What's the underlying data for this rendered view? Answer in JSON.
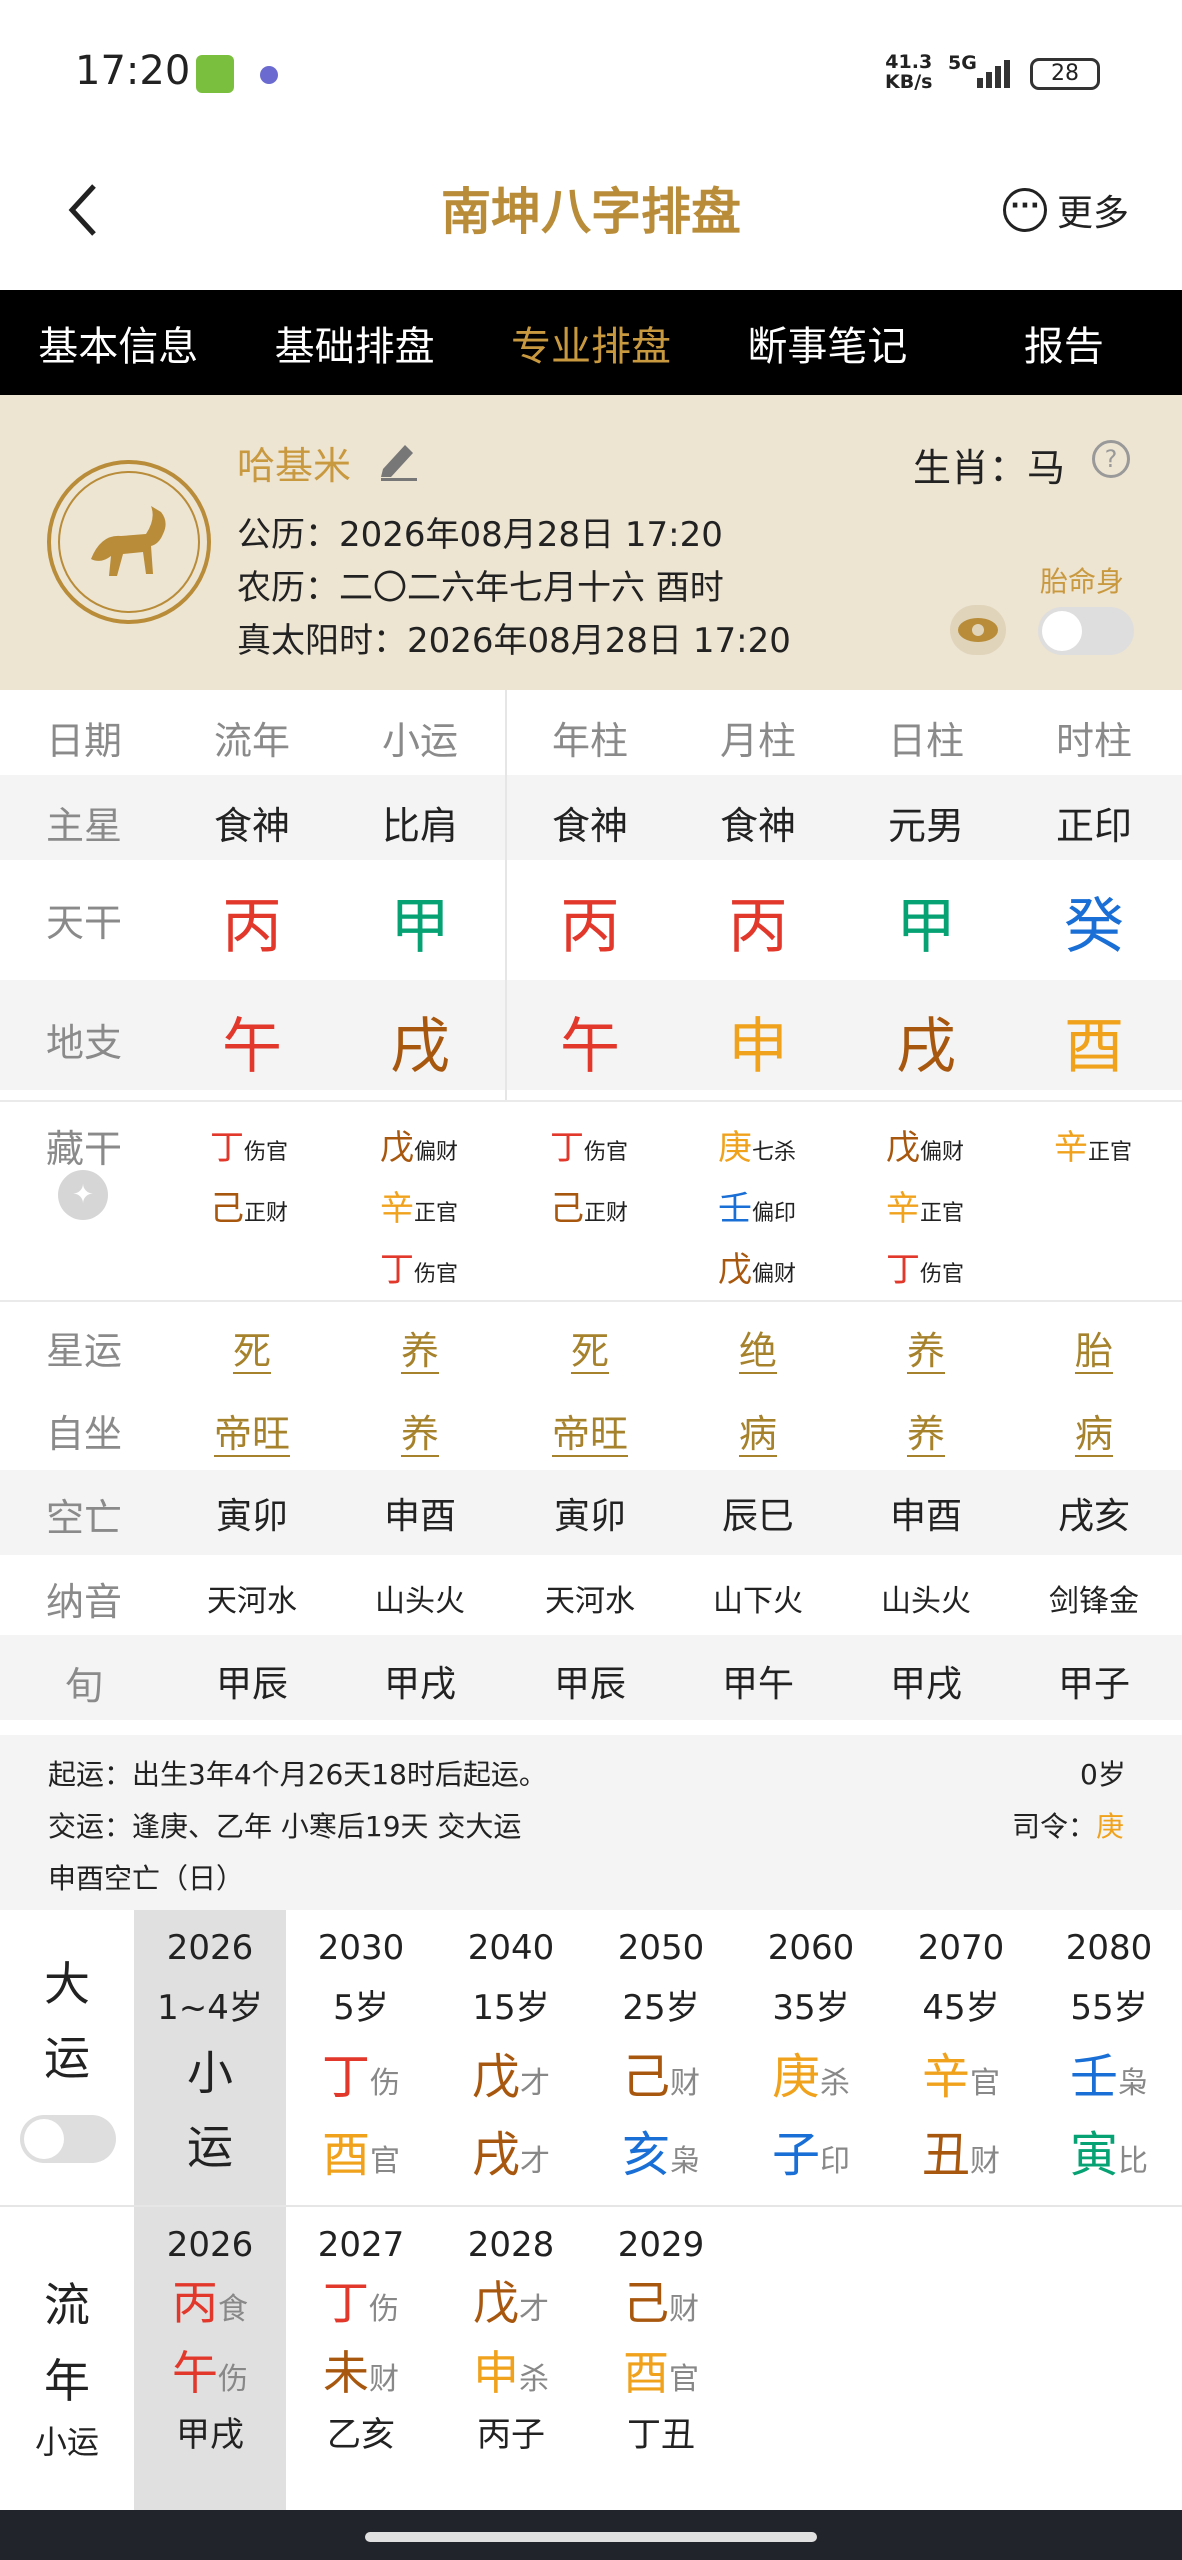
{
  "status": {
    "time": "17:20",
    "net_speed_top": "41.3",
    "net_speed_unit": "KB/s",
    "network": "5G",
    "battery": "28"
  },
  "header": {
    "title": "南坤八字排盘",
    "more": "更多"
  },
  "tabs": [
    "基本信息",
    "基础排盘",
    "专业排盘",
    "断事笔记",
    "报告"
  ],
  "profile": {
    "name": "哈基米",
    "zodiac_label": "生肖：",
    "zodiac": "马",
    "solar": "公历：2026年08月28日 17:20",
    "lunar": "农历：二〇二六年七月十六 酉时",
    "true_solar": "真太阳时：2026年08月28日 17:20",
    "taiming": "胎命身"
  },
  "table": {
    "headers": [
      "日期",
      "流年",
      "小运",
      "年柱",
      "月柱",
      "日柱",
      "时柱"
    ],
    "main_star_label": "主星",
    "main_star": [
      "食神",
      "比肩",
      "食神",
      "食神",
      "元男",
      "正印"
    ],
    "tiangan_label": "天干",
    "tiangan": [
      "丙",
      "甲",
      "丙",
      "丙",
      "甲",
      "癸"
    ],
    "dizhi_label": "地支",
    "dizhi": [
      "午",
      "戌",
      "午",
      "申",
      "戌",
      "酉"
    ],
    "canggan_label": "藏干",
    "canggan": [
      [
        [
          "丁",
          "伤官"
        ],
        [
          "己",
          "正财"
        ]
      ],
      [
        [
          "戊",
          "偏财"
        ],
        [
          "辛",
          "正官"
        ],
        [
          "丁",
          "伤官"
        ]
      ],
      [
        [
          "丁",
          "伤官"
        ],
        [
          "己",
          "正财"
        ]
      ],
      [
        [
          "庚",
          "七杀"
        ],
        [
          "壬",
          "偏印"
        ],
        [
          "戊",
          "偏财"
        ]
      ],
      [
        [
          "戊",
          "偏财"
        ],
        [
          "辛",
          "正官"
        ],
        [
          "丁",
          "伤官"
        ]
      ],
      [
        [
          "辛",
          "正官"
        ]
      ]
    ],
    "xingyun_label": "星运",
    "xingyun": [
      "死",
      "养",
      "死",
      "绝",
      "养",
      "胎"
    ],
    "zizuo_label": "自坐",
    "zizuo": [
      "帝旺",
      "养",
      "帝旺",
      "病",
      "养",
      "病"
    ],
    "kongwang_label": "空亡",
    "kongwang": [
      "寅卯",
      "申酉",
      "寅卯",
      "辰巳",
      "申酉",
      "戌亥"
    ],
    "nayin_label": "纳音",
    "nayin": [
      "天河水",
      "山头火",
      "天河水",
      "山下火",
      "山头火",
      "剑锋金"
    ],
    "xun_label": "旬",
    "xun": [
      "甲辰",
      "甲戌",
      "甲辰",
      "甲午",
      "甲戌",
      "甲子"
    ]
  },
  "info": {
    "qiyun": "起运：出生3年4个月26天18时后起运。",
    "age": "0岁",
    "jiaoyun": "交运：逢庚、乙年 小寒后19天 交大运",
    "siling_label": "司令：",
    "siling": "庚",
    "kongwang_note": "申酉空亡（日）"
  },
  "dayun": {
    "label_1": "大",
    "label_2": "运",
    "first": {
      "year": "2026",
      "age": "1~4岁",
      "l1": "小",
      "l2": "运"
    },
    "items": [
      {
        "year": "2030",
        "age": "5岁",
        "g": "丁",
        "gs": "伤",
        "z": "酉",
        "zs": "官"
      },
      {
        "year": "2040",
        "age": "15岁",
        "g": "戊",
        "gs": "才",
        "z": "戌",
        "zs": "才"
      },
      {
        "year": "2050",
        "age": "25岁",
        "g": "己",
        "gs": "财",
        "z": "亥",
        "zs": "枭"
      },
      {
        "year": "2060",
        "age": "35岁",
        "g": "庚",
        "gs": "杀",
        "z": "子",
        "zs": "印"
      },
      {
        "year": "2070",
        "age": "45岁",
        "g": "辛",
        "gs": "官",
        "z": "丑",
        "zs": "财"
      },
      {
        "year": "2080",
        "age": "55岁",
        "g": "壬",
        "gs": "枭",
        "z": "寅",
        "zs": "比"
      }
    ]
  },
  "liunian": {
    "label_1": "流",
    "label_2": "年",
    "label_3": "小运",
    "items": [
      {
        "year": "2026",
        "g": "丙",
        "gs": "食",
        "z": "午",
        "zs": "伤",
        "xy": "甲戌"
      },
      {
        "year": "2027",
        "g": "丁",
        "gs": "伤",
        "z": "未",
        "zs": "财",
        "xy": "乙亥"
      },
      {
        "year": "2028",
        "g": "戊",
        "gs": "才",
        "z": "申",
        "zs": "杀",
        "xy": "丙子"
      },
      {
        "year": "2029",
        "g": "己",
        "gs": "财",
        "z": "酉",
        "zs": "官",
        "xy": "丁丑"
      }
    ]
  },
  "colors": {
    "gold": "#c9993f",
    "red": "#e2382c",
    "green": "#06a274",
    "blue": "#1a6fd6",
    "orange": "#f0a21d",
    "brown": "#a8570e"
  }
}
